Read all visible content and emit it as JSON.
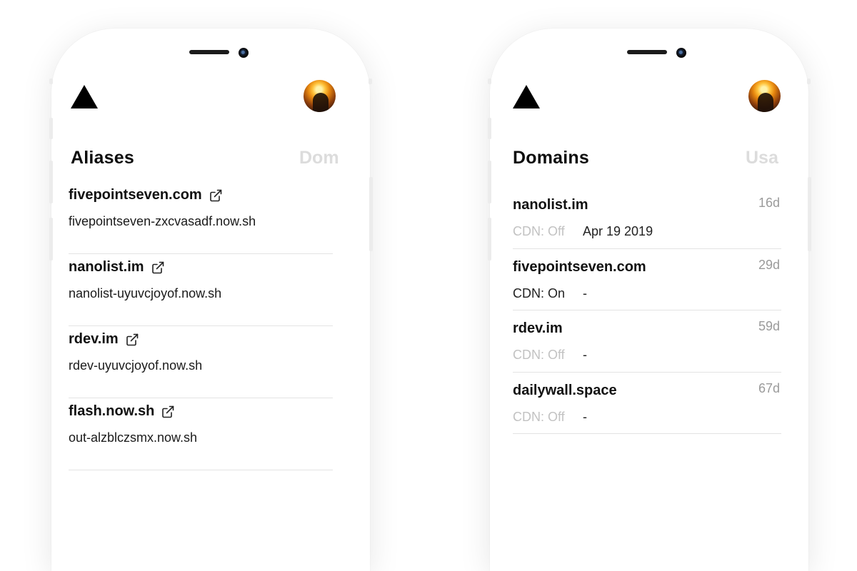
{
  "aliases_screen": {
    "title": "Aliases",
    "next_tab": "Dom",
    "items": [
      {
        "name": "fivepointseven.com",
        "target": "fivepointseven-zxcvasadf.now.sh",
        "icon": "external-link-icon"
      },
      {
        "name": "nanolist.im",
        "target": "nanolist-uyuvcjoyof.now.sh",
        "icon": "external-link-icon"
      },
      {
        "name": "rdev.im",
        "target": "rdev-uyuvcjoyof.now.sh",
        "icon": "external-link-icon"
      },
      {
        "name": "flash.now.sh",
        "target": "out-alzblczsmx.now.sh",
        "icon": "external-link-icon"
      }
    ]
  },
  "domains_screen": {
    "title": "Domains",
    "next_tab": "Usa",
    "items": [
      {
        "name": "nanolist.im",
        "age": "16d",
        "cdn": "CDN: Off",
        "expiry": "Apr 19 2019"
      },
      {
        "name": "fivepointseven.com",
        "age": "29d",
        "cdn": "CDN: On",
        "expiry": "-"
      },
      {
        "name": "rdev.im",
        "age": "59d",
        "cdn": "CDN: Off",
        "expiry": "-"
      },
      {
        "name": "dailywall.space",
        "age": "67d",
        "cdn": "CDN: Off",
        "expiry": "-"
      }
    ]
  },
  "colors": {
    "title": "#0d0d0d",
    "inactive_tab": "#dcdcdc",
    "muted": "#c2c2c2",
    "age": "#9a9a9a",
    "divider": "#e3e3e3"
  },
  "icons": {
    "logo": "triangle-logo-icon",
    "avatar": "user-avatar",
    "link": "external-link-icon"
  }
}
